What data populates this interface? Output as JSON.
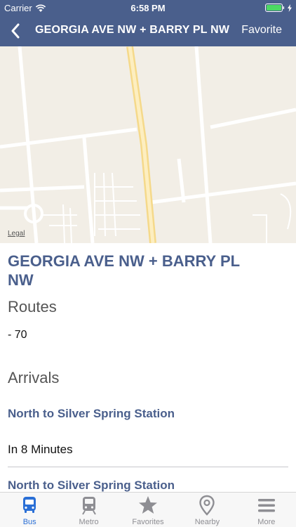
{
  "status": {
    "carrier": "Carrier",
    "time": "6:58 PM"
  },
  "nav": {
    "title": "GEORGIA AVE NW + BARRY PL NW",
    "favorite_label": "Favorite"
  },
  "map": {
    "legal": "Legal"
  },
  "stop": {
    "title": "GEORGIA AVE NW + BARRY PL NW",
    "routes_heading": "Routes",
    "routes": [
      "- 70"
    ],
    "arrivals_heading": "Arrivals",
    "arrivals": [
      {
        "destination": "North to Silver Spring Station",
        "time": "In 8 Minutes"
      },
      {
        "destination": "North to Silver Spring Station",
        "time": ""
      }
    ]
  },
  "tabs": [
    {
      "label": "Bus",
      "icon": "bus-icon",
      "active": true
    },
    {
      "label": "Metro",
      "icon": "train-icon",
      "active": false
    },
    {
      "label": "Favorites",
      "icon": "star-icon",
      "active": false
    },
    {
      "label": "Nearby",
      "icon": "location-pin-icon",
      "active": false
    },
    {
      "label": "More",
      "icon": "menu-icon",
      "active": false
    }
  ],
  "colors": {
    "brand": "#4a5f8c",
    "tab_active": "#2a6fd6",
    "tab_inactive": "#8e8e93"
  }
}
